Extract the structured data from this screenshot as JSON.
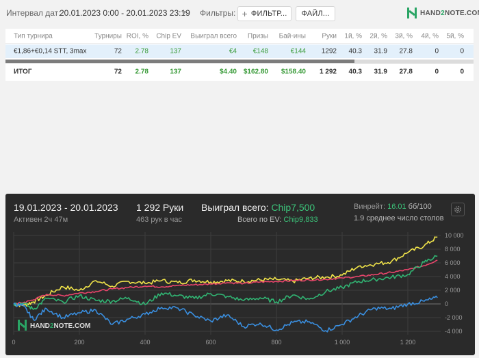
{
  "topbar": {
    "interval_label": "Интервал дат:",
    "interval_value": "20.01.2023 0:00 - 20.01.2023 23:19",
    "filters_label": "Фильтры:",
    "filter_button": "ФИЛЬТР...",
    "file_button": "ФАЙЛ...",
    "logo_prefix": "HAND",
    "logo_two": "2",
    "logo_suffix": "NOTE.COM"
  },
  "table": {
    "headers": [
      "Тип турнира",
      "Турниры",
      "ROI, %",
      "Chip EV",
      "Выиграл всего",
      "Призы",
      "Бай-ины",
      "Руки",
      "1й, %",
      "2й, %",
      "3й, %",
      "4й, %",
      "5й, %"
    ],
    "row": [
      "€1,86+€0,14 STT, 3max",
      "72",
      "2.78",
      "137",
      "€4",
      "€148",
      "€144",
      "1292",
      "40.3",
      "31.9",
      "27.8",
      "0",
      "0"
    ],
    "total": [
      "ИТОГ",
      "72",
      "2.78",
      "137",
      "$4.40",
      "$162.80",
      "$158.40",
      "1 292",
      "40.3",
      "31.9",
      "27.8",
      "0",
      "0"
    ]
  },
  "graph": {
    "date_range": "19.01.2023 - 20.01.2023",
    "active": "Активен 2ч 47м",
    "hands": "1 292 Руки",
    "hands_rate": "463 рук в час",
    "won_label": "Выиграл всего: ",
    "won_value": "Chip7,500",
    "ev_label": "Всего по EV: ",
    "ev_value": "Chip9,833",
    "winrate_label": "Винрейт: ",
    "winrate_value": "16.01",
    "winrate_unit": " бб/100",
    "tables_avg": "1.9 среднее число столов",
    "watermark_prefix": "HAND",
    "watermark_two": "2",
    "watermark_suffix": "NOTE.COM"
  },
  "chart_data": {
    "type": "line",
    "xlim": [
      0,
      1300
    ],
    "ylim": [
      -4500,
      10500
    ],
    "x_ticks": [
      "0",
      "200",
      "400",
      "600",
      "800",
      "1 000",
      "1 200"
    ],
    "x_tick_values": [
      0,
      200,
      400,
      600,
      800,
      1000,
      1200
    ],
    "y_ticks": [
      "10 000",
      "8 000",
      "6 000",
      "4 000",
      "2 000",
      "0",
      "-2 000",
      "-4 000"
    ],
    "y_tick_values": [
      10000,
      8000,
      6000,
      4000,
      2000,
      0,
      -2000,
      -4000
    ],
    "grid": true,
    "series": [
      {
        "color": "#f2e54a",
        "x": [
          0,
          30,
          60,
          100,
          150,
          200,
          250,
          300,
          350,
          400,
          450,
          500,
          550,
          600,
          650,
          700,
          750,
          800,
          850,
          900,
          950,
          1000,
          1050,
          1100,
          1150,
          1200,
          1250,
          1290
        ],
        "y": [
          0,
          -200,
          300,
          1300,
          2500,
          2000,
          3400,
          2600,
          3300,
          3000,
          3400,
          3100,
          3500,
          3200,
          3400,
          3300,
          3500,
          3600,
          3300,
          3800,
          3900,
          4200,
          5500,
          5800,
          6200,
          7500,
          8500,
          9800
        ]
      },
      {
        "color": "#e8456b",
        "x": [
          0,
          30,
          60,
          100,
          150,
          200,
          250,
          300,
          350,
          400,
          450,
          500,
          550,
          600,
          650,
          700,
          750,
          800,
          850,
          900,
          950,
          1000,
          1050,
          1100,
          1150,
          1200,
          1250,
          1290
        ],
        "y": [
          0,
          200,
          600,
          1400,
          1200,
          1600,
          1800,
          2200,
          2400,
          2600,
          2500,
          2700,
          2800,
          2900,
          3100,
          3000,
          3200,
          3300,
          3400,
          3500,
          3600,
          3800,
          4000,
          4300,
          4600,
          5000,
          5600,
          6400
        ]
      },
      {
        "color": "#31b573",
        "x": [
          0,
          30,
          60,
          100,
          150,
          200,
          250,
          300,
          350,
          400,
          450,
          500,
          550,
          600,
          650,
          700,
          750,
          800,
          850,
          900,
          950,
          1000,
          1050,
          1100,
          1150,
          1200,
          1250,
          1290
        ],
        "y": [
          0,
          100,
          -800,
          800,
          300,
          1200,
          500,
          400,
          900,
          -100,
          1600,
          1200,
          800,
          1500,
          1100,
          500,
          900,
          300,
          1300,
          700,
          1800,
          2400,
          3300,
          3600,
          3900,
          4300,
          6100,
          7000
        ]
      },
      {
        "color": "#3a8fe0",
        "x": [
          0,
          30,
          60,
          100,
          150,
          200,
          250,
          300,
          350,
          400,
          450,
          500,
          550,
          600,
          650,
          700,
          750,
          800,
          850,
          900,
          950,
          1000,
          1050,
          1100,
          1150,
          1200,
          1250,
          1290
        ],
        "y": [
          0,
          -300,
          -2300,
          -700,
          -2000,
          -1300,
          -900,
          -3000,
          -2200,
          -1500,
          -500,
          -600,
          -1700,
          -2500,
          -1600,
          -3300,
          -2800,
          -3800,
          -2700,
          -2600,
          -3900,
          -3000,
          -1700,
          -600,
          -700,
          0,
          400,
          900
        ]
      }
    ]
  }
}
